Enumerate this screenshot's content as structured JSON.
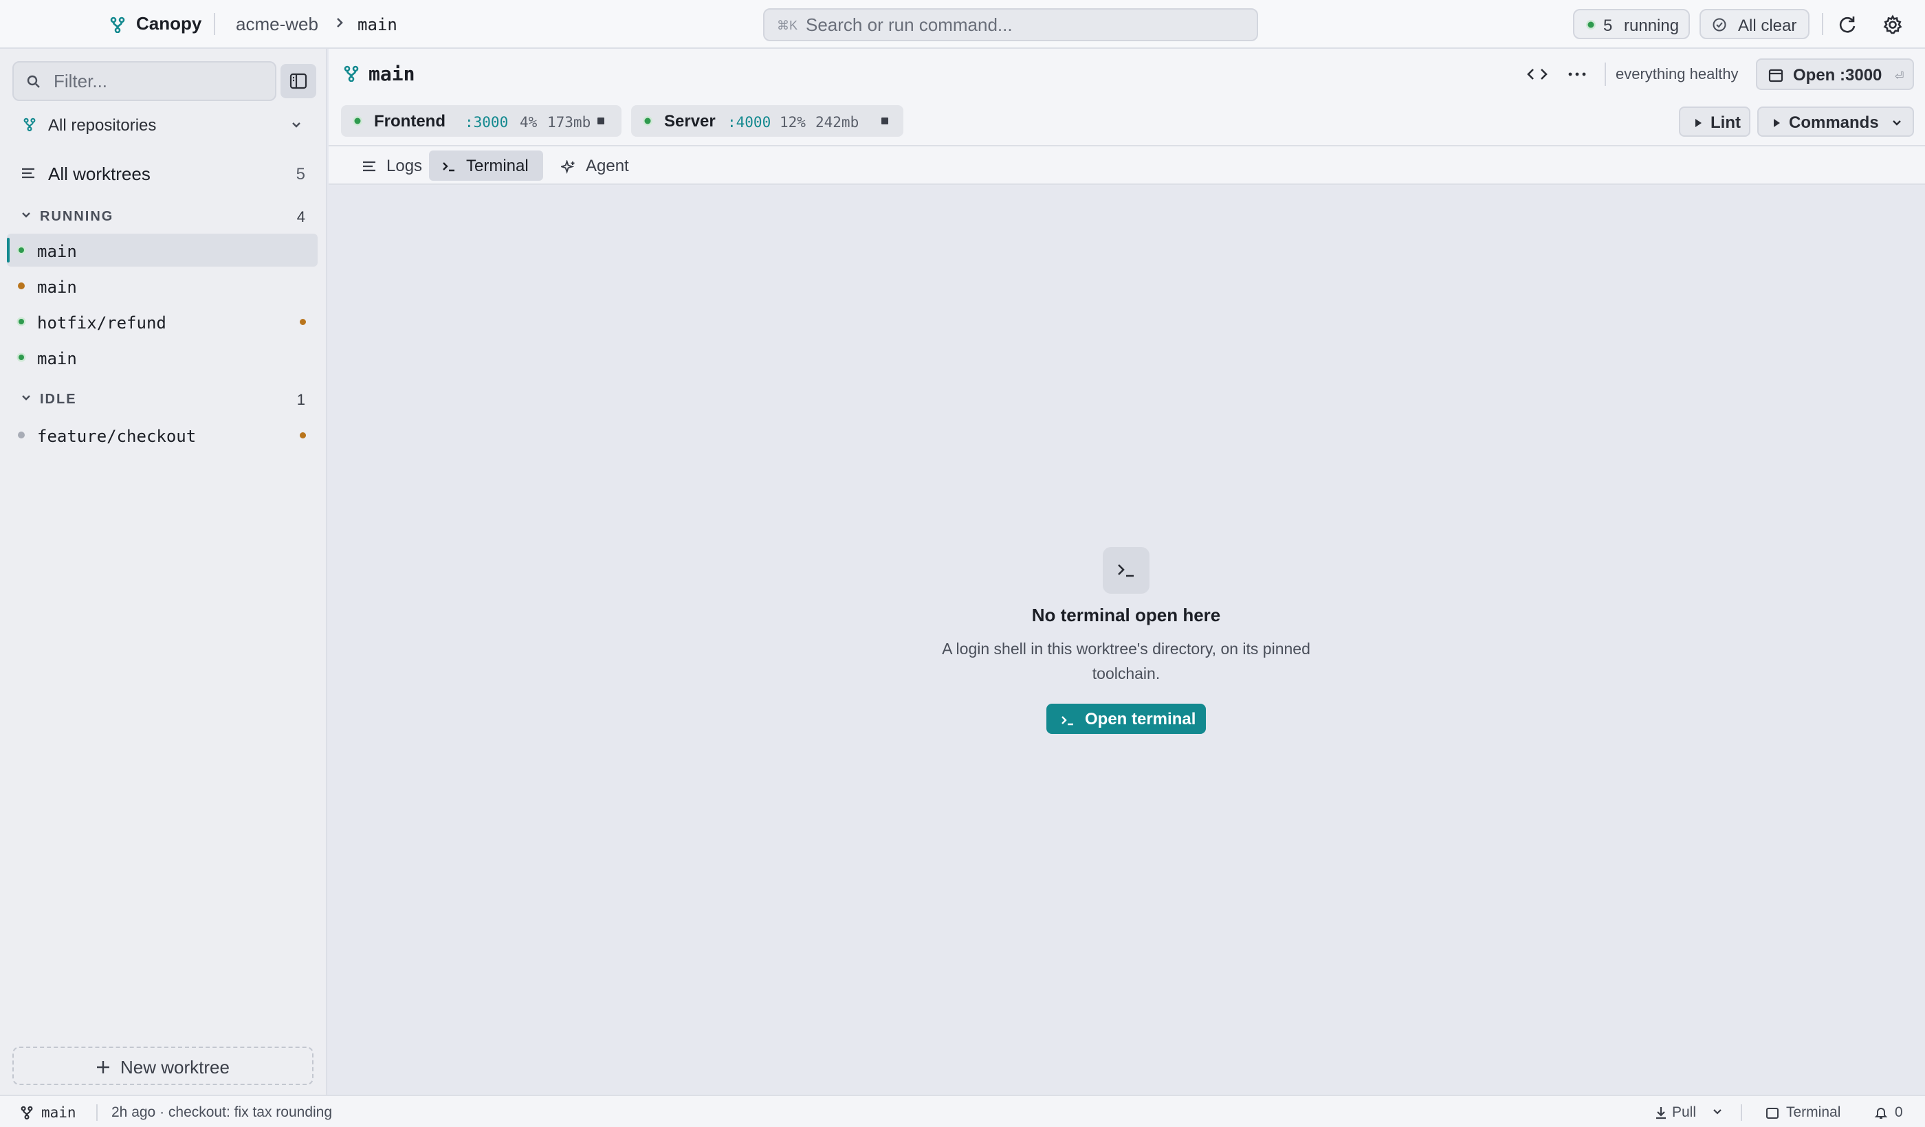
{
  "app": {
    "name": "Canopy",
    "repo": "acme-web",
    "branch": "main"
  },
  "search": {
    "shortcut": "⌘K",
    "placeholder": "Search or run command..."
  },
  "status_pills": {
    "running_count": "5",
    "running_label": "running",
    "clear_label": "All clear"
  },
  "sidebar": {
    "filter_placeholder": "Filter...",
    "repo_selector": "All repositories",
    "all_worktrees_label": "All worktrees",
    "all_worktrees_count": "5",
    "sections": [
      {
        "label": "RUNNING",
        "count": "4",
        "items": [
          {
            "name": "main",
            "status": "running",
            "modified": false,
            "active": true
          },
          {
            "name": "main",
            "status": "warning",
            "modified": false,
            "active": false
          },
          {
            "name": "hotfix/refund",
            "status": "running",
            "modified": true,
            "active": false
          },
          {
            "name": "main",
            "status": "running",
            "modified": false,
            "active": false
          }
        ]
      },
      {
        "label": "IDLE",
        "count": "1",
        "items": [
          {
            "name": "feature/checkout",
            "status": "idle",
            "modified": true,
            "active": false
          }
        ]
      }
    ],
    "new_worktree_label": "New worktree"
  },
  "main": {
    "title": "main",
    "health": "everything healthy",
    "open_button": "Open :3000",
    "open_hint": "⏎",
    "services": [
      {
        "name": "Frontend",
        "port": ":3000",
        "cpu": "4%",
        "mem": "173mb"
      },
      {
        "name": "Server",
        "port": ":4000",
        "cpu": "12%",
        "mem": "242mb"
      }
    ],
    "actions": {
      "lint": "Lint",
      "commands": "Commands"
    },
    "tabs": [
      {
        "label": "Logs",
        "active": false
      },
      {
        "label": "Terminal",
        "active": true
      },
      {
        "label": "Agent",
        "active": false
      }
    ],
    "empty_state": {
      "title": "No terminal open here",
      "description": "A login shell in this worktree's directory, on its pinned toolchain.",
      "button": "Open terminal"
    }
  },
  "statusbar": {
    "branch": "main",
    "last_commit": "2h ago · checkout: fix tax rounding",
    "pull": "Pull",
    "terminal": "Terminal",
    "notifications": "0"
  },
  "colors": {
    "accent": "#13898f",
    "running": "#2e9a4e",
    "warning": "#b9751d",
    "idle": "#a8acb6"
  }
}
